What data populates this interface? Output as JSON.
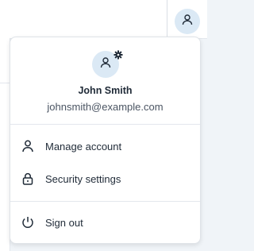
{
  "user": {
    "name": "John Smith",
    "email": "johnsmith@example.com"
  },
  "icons": {
    "avatar": "user-icon",
    "profile_avatar": "user-icon",
    "badge": "gear-icon",
    "manage": "person-icon",
    "security": "lock-icon",
    "signout": "power-icon"
  },
  "menu": {
    "manage_label": "Manage account",
    "security_label": "Security settings",
    "signout_label": "Sign out"
  },
  "colors": {
    "avatar_bg": "#dbe9f5",
    "text_primary": "#1f2a37",
    "text_secondary": "#4b5563"
  }
}
